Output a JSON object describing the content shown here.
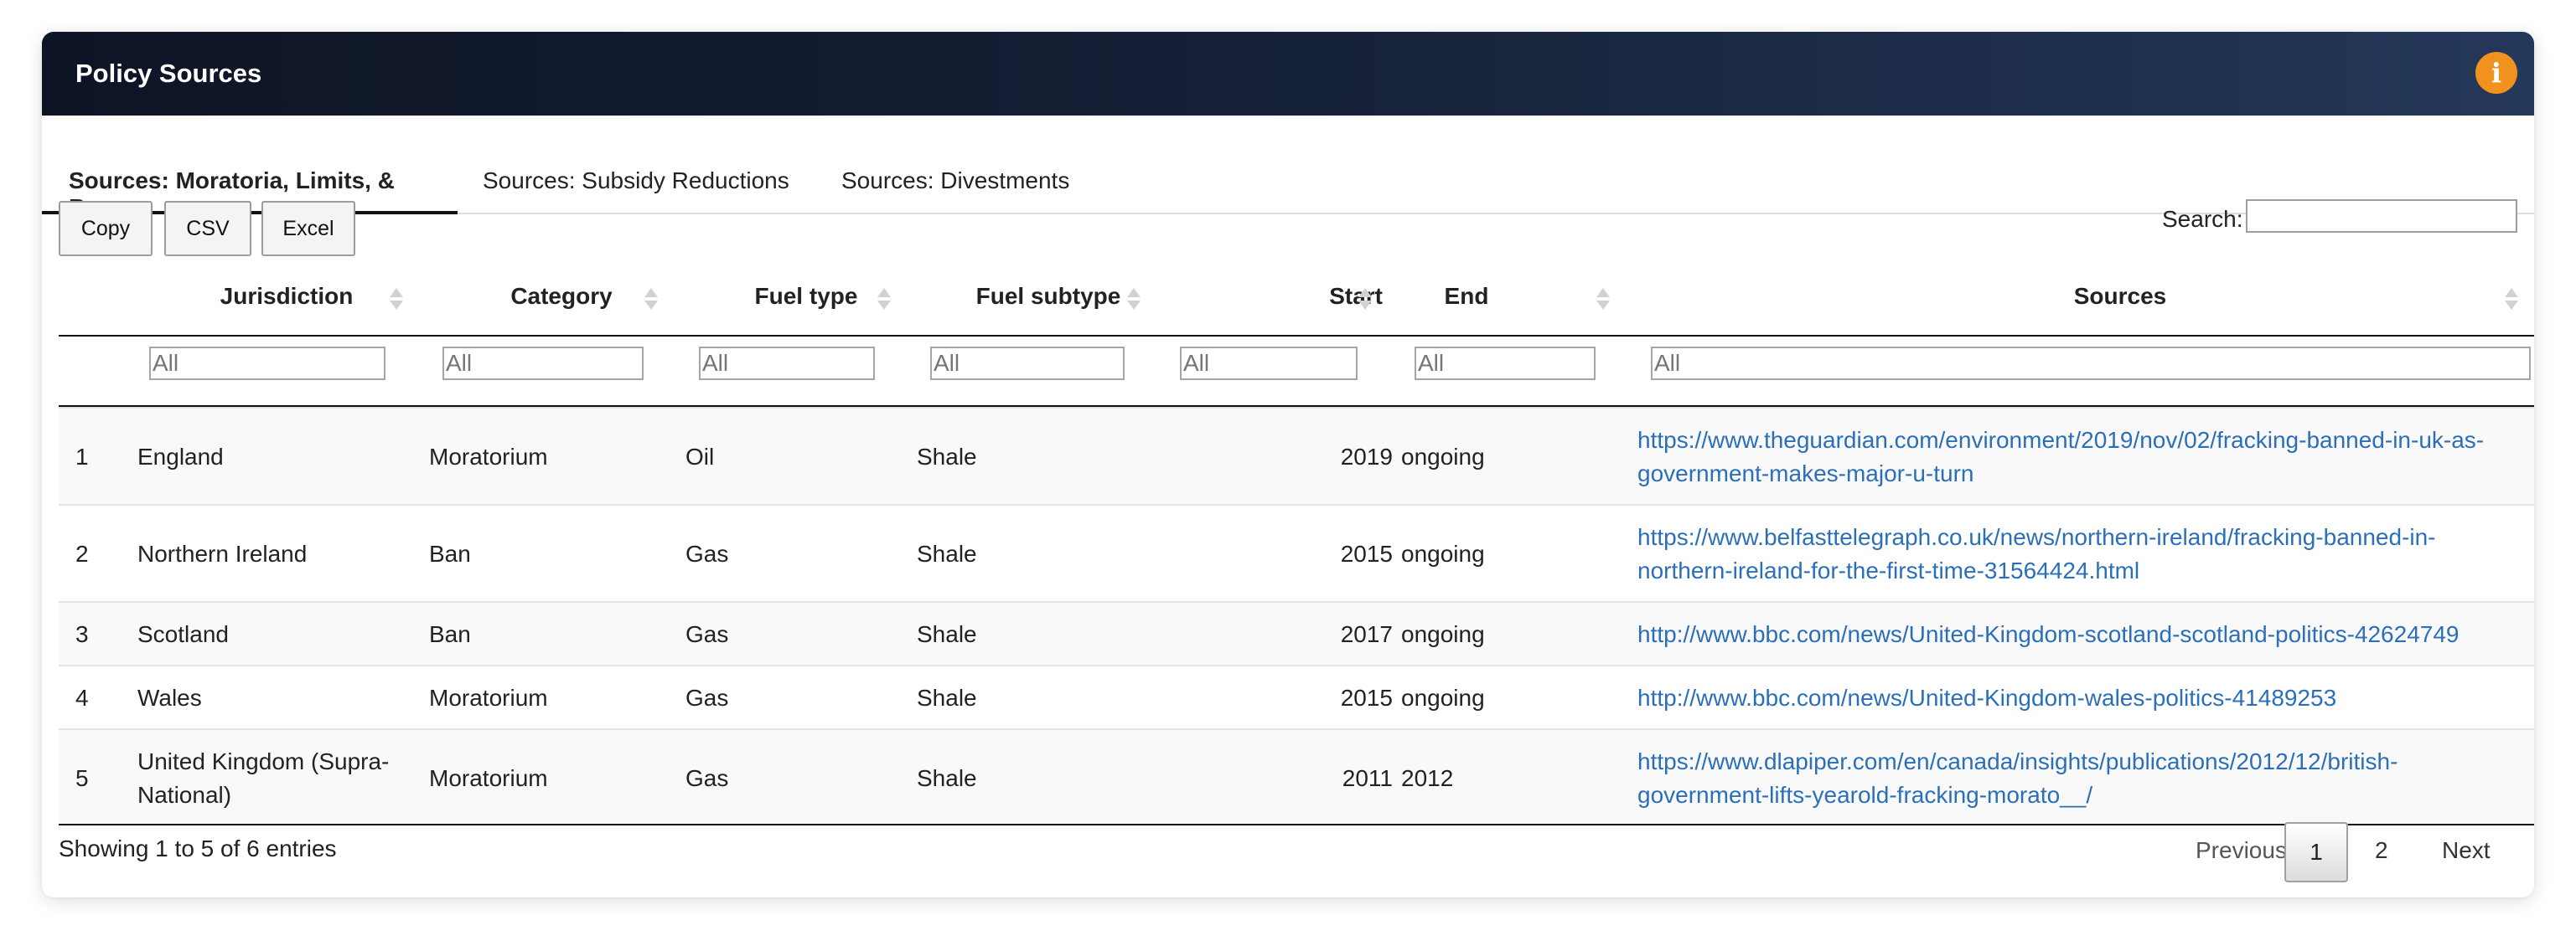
{
  "panel": {
    "title": "Policy Sources",
    "info_icon": "info-icon",
    "accent": "#f2921e"
  },
  "tabs": [
    {
      "label": "Sources: Moratoria, Limits, & Bans",
      "active": true
    },
    {
      "label": "Sources: Subsidy Reductions",
      "active": false
    },
    {
      "label": "Sources: Divestments",
      "active": false
    }
  ],
  "toolbar": {
    "copy": "Copy",
    "csv": "CSV",
    "excel": "Excel"
  },
  "search": {
    "label": "Search:",
    "value": ""
  },
  "columns": [
    "Jurisdiction",
    "Category",
    "Fuel type",
    "Fuel subtype",
    "Start",
    "End",
    "Sources"
  ],
  "filters": {
    "placeholder": "All"
  },
  "rows": [
    {
      "index": "1",
      "jurisdiction": "England",
      "category": "Moratorium",
      "fuel_type": "Oil",
      "fuel_subtype": "Shale",
      "start": "2019",
      "end": "ongoing",
      "source_line1": "https://www.theguardian.com/environment/2019/nov/02/fracking-banned-in-uk-as-",
      "source_line2": "government-makes-major-u-turn"
    },
    {
      "index": "2",
      "jurisdiction": "Northern Ireland",
      "category": "Ban",
      "fuel_type": "Gas",
      "fuel_subtype": "Shale",
      "start": "2015",
      "end": "ongoing",
      "source_line1": "https://www.belfasttelegraph.co.uk/news/northern-ireland/fracking-banned-in-",
      "source_line2": "northern-ireland-for-the-first-time-31564424.html"
    },
    {
      "index": "3",
      "jurisdiction": "Scotland",
      "category": "Ban",
      "fuel_type": "Gas",
      "fuel_subtype": "Shale",
      "start": "2017",
      "end": "ongoing",
      "source_line1": "http://www.bbc.com/news/United-Kingdom-scotland-scotland-politics-42624749",
      "source_line2": ""
    },
    {
      "index": "4",
      "jurisdiction": "Wales",
      "category": "Moratorium",
      "fuel_type": "Gas",
      "fuel_subtype": "Shale",
      "start": "2015",
      "end": "ongoing",
      "source_line1": "http://www.bbc.com/news/United-Kingdom-wales-politics-41489253",
      "source_line2": ""
    },
    {
      "index": "5",
      "jurisdiction_line1": "United Kingdom (Supra-",
      "jurisdiction_line2": "National)",
      "category": "Moratorium",
      "fuel_type": "Gas",
      "fuel_subtype": "Shale",
      "start": "2011",
      "end": "2012",
      "source_line1": "https://www.dlapiper.com/en/canada/insights/publications/2012/12/british-",
      "source_line2": "government-lifts-yearold-fracking-morato__/"
    }
  ],
  "footer": {
    "info": "Showing 1 to 5 of 6 entries",
    "previous": "Previous",
    "pages": [
      "1",
      "2"
    ],
    "current_page": "1",
    "next": "Next"
  }
}
